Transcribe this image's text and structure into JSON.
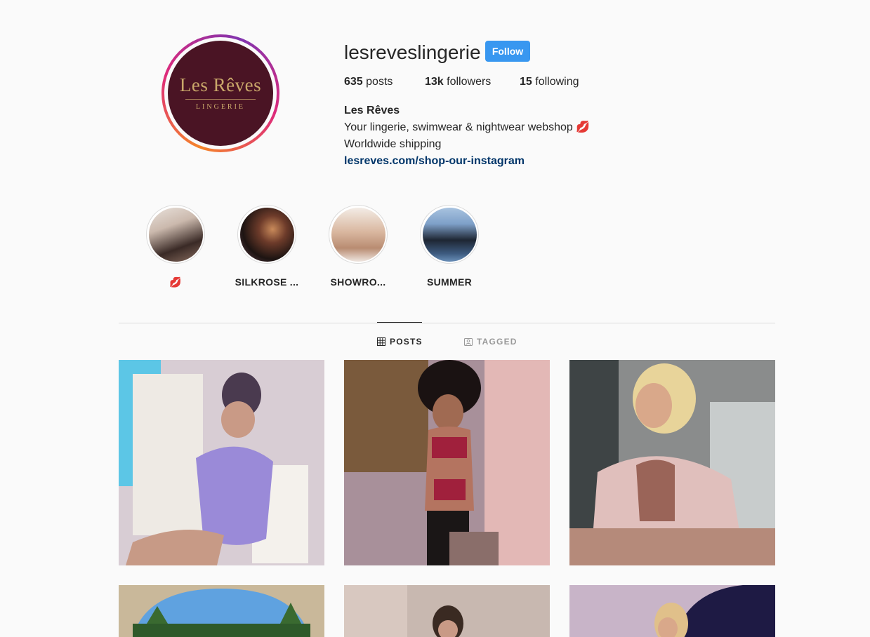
{
  "profile": {
    "avatar_logo_main": "Les Rêves",
    "avatar_logo_sub": "LINGERIE",
    "username": "lesreveslingerie",
    "follow_label": "Follow",
    "posts_count": "635",
    "posts_label": "posts",
    "followers_count": "13k",
    "followers_label": "followers",
    "following_count": "15",
    "following_label": "following",
    "display_name": "Les Rêves",
    "bio_line1": "Your lingerie, swimwear & nightwear webshop 💋",
    "bio_line2": "Worldwide shipping",
    "link": "lesreves.com/shop-our-instagram"
  },
  "highlights": [
    {
      "label": "💋"
    },
    {
      "label": "SILKROSE ..."
    },
    {
      "label": "SHOWRO..."
    },
    {
      "label": "SUMMER"
    }
  ],
  "tabs": [
    {
      "label": "POSTS",
      "icon": "grid-icon",
      "active": true
    },
    {
      "label": "TAGGED",
      "icon": "tagged-icon",
      "active": false
    }
  ],
  "colors": {
    "follow": "#3897f0",
    "link": "#003569",
    "avatar_bg": "#4a1424",
    "logo_gold": "#c9a76a"
  }
}
